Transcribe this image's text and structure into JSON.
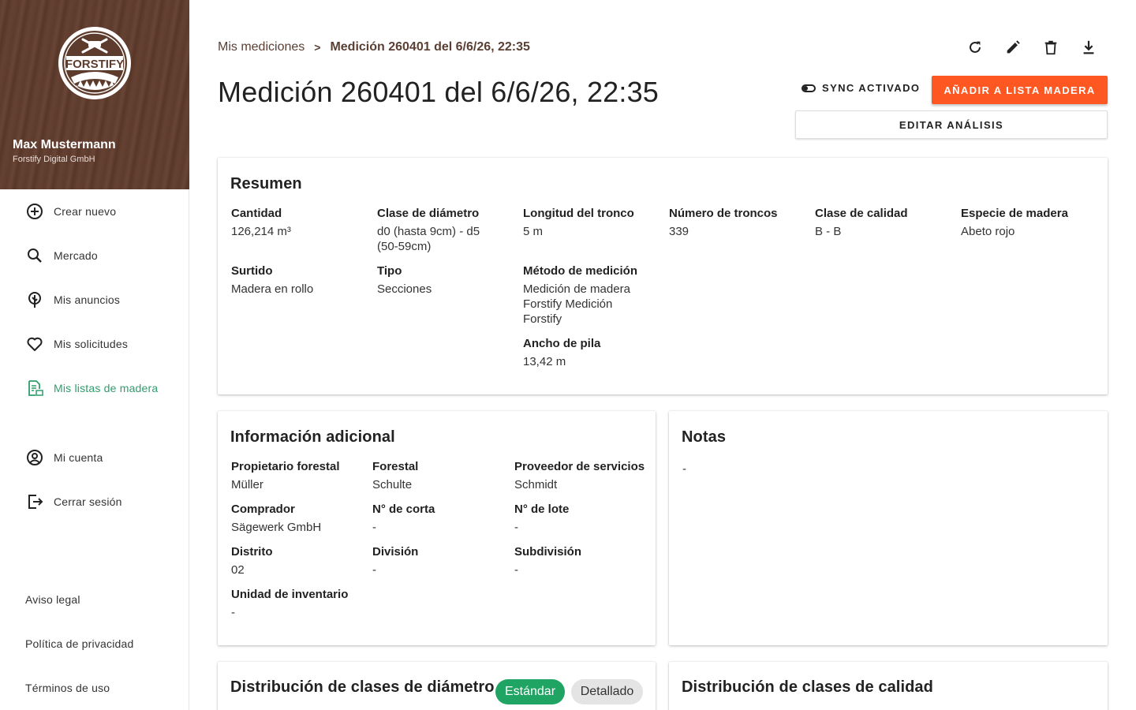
{
  "sidebar": {
    "logo_text": "FORSTIFY",
    "user_name": "Max Mustermann",
    "company": "Forstify Digital GmbH",
    "nav": [
      {
        "label": "Crear nuevo",
        "icon": "plus-circle-icon"
      },
      {
        "label": "Mercado",
        "icon": "search-icon"
      },
      {
        "label": "Mis anuncios",
        "icon": "tree-icon"
      },
      {
        "label": "Mis solicitudes",
        "icon": "heart-icon"
      },
      {
        "label": "Mis listas de madera",
        "icon": "document-list-icon",
        "active": true
      },
      {
        "label": "Mi cuenta",
        "icon": "account-circle-icon"
      },
      {
        "label": "Cerrar sesión",
        "icon": "logout-icon"
      }
    ],
    "footer": [
      "Aviso legal",
      "Política de privacidad",
      "Términos de uso"
    ]
  },
  "breadcrumb": {
    "parent": "Mis mediciones",
    "separator": ">",
    "current": "Medición 260401 del 6/6/26, 22:35"
  },
  "toolbar_icons": [
    "refresh-icon",
    "edit-icon",
    "delete-icon",
    "download-icon"
  ],
  "page_title": "Medición 260401 del 6/6/26, 22:35",
  "sync_label": "SYNC ACTIVADO",
  "primary_button": "AÑADIR A LISTA MADERA",
  "secondary_button": "EDITAR ANÁLISIS",
  "summary": {
    "title": "Resumen",
    "fields": [
      {
        "label": "Cantidad",
        "value": "126,214 m³"
      },
      {
        "label": "Clase de diámetro",
        "value": "d0 (hasta 9cm) - d5 (50-59cm)"
      },
      {
        "label": "Longitud del tronco",
        "value": "5 m"
      },
      {
        "label": "Número de troncos",
        "value": "339"
      },
      {
        "label": "Clase de calidad",
        "value": "B - B"
      },
      {
        "label": "Especie de madera",
        "value": "Abeto rojo"
      },
      {
        "label": "Surtido",
        "value": "Madera en rollo"
      },
      {
        "label": "Tipo",
        "value": "Secciones"
      },
      {
        "label": "Método de medición",
        "value": "Medición de madera Forstify Medición Forstify"
      },
      {
        "label": "Ancho de pila",
        "value": "13,42 m"
      }
    ]
  },
  "additional": {
    "title": "Información adicional",
    "fields": [
      {
        "label": "Propietario forestal",
        "value": "Müller"
      },
      {
        "label": "Forestal",
        "value": "Schulte"
      },
      {
        "label": "Proveedor de servicios",
        "value": "Schmidt"
      },
      {
        "label": "Comprador",
        "value": "Sägewerk GmbH"
      },
      {
        "label": "N° de corta",
        "value": "-"
      },
      {
        "label": "N° de lote",
        "value": "-"
      },
      {
        "label": "Distrito",
        "value": "02"
      },
      {
        "label": "División",
        "value": "-"
      },
      {
        "label": "Subdivisión",
        "value": "-"
      },
      {
        "label": "Unidad de inventario",
        "value": "-"
      }
    ]
  },
  "notes": {
    "title": "Notas",
    "value": "-"
  },
  "diameter": {
    "title": "Distribución de clases de diámetro",
    "chip_standard": "Estándar",
    "chip_detailed": "Detallado"
  },
  "quality": {
    "title": "Distribución de clases de calidad"
  },
  "colors": {
    "accent": "#ff5722",
    "active_green": "#2e9e6a",
    "chip_green": "#1fa463",
    "brand_brown": "#5b3a2c"
  }
}
